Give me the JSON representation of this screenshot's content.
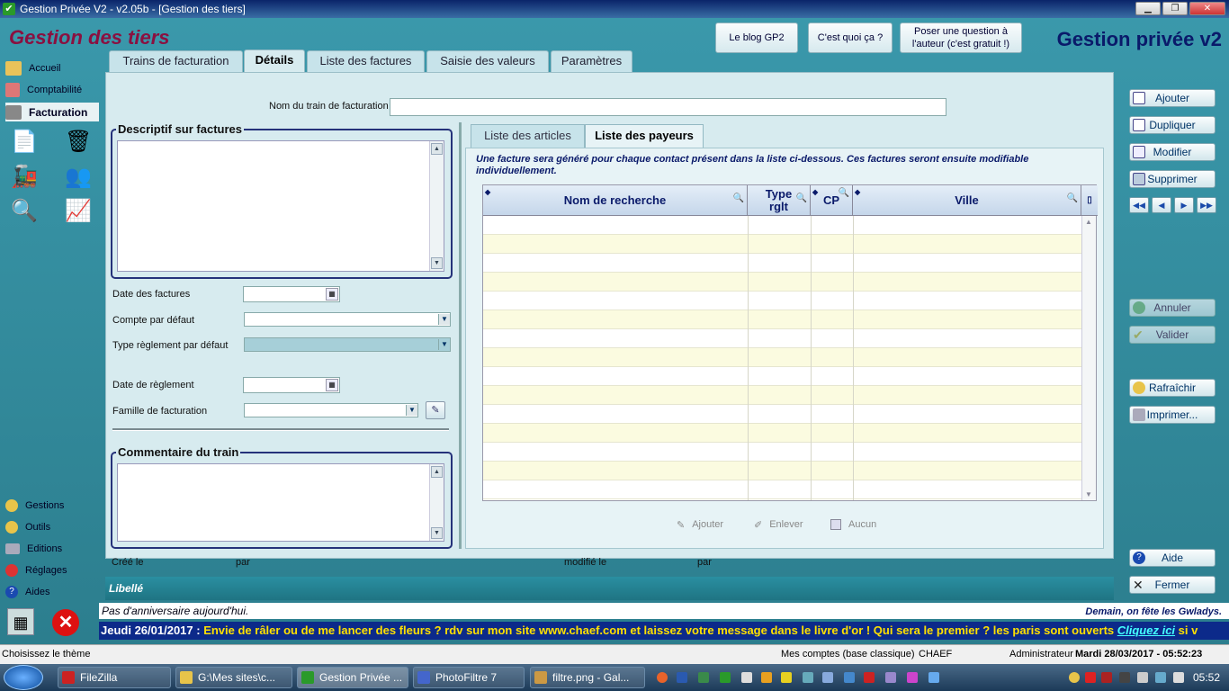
{
  "window": {
    "title": "Gestion Privée V2 - v2.05b - [Gestion des tiers]"
  },
  "header": {
    "page_title": "Gestion des tiers",
    "app_title": "Gestion privée v2",
    "buttons": {
      "blog": "Le blog GP2",
      "what": "C'est quoi ça ?",
      "question_l1": "Poser une question à",
      "question_l2": "l'auteur (c'est gratuit !)"
    }
  },
  "nav": {
    "top": [
      "Accueil",
      "Comptabilité",
      "Facturation"
    ],
    "bottom": [
      "Gestions",
      "Outils",
      "Editions",
      "Réglages",
      "Aides"
    ]
  },
  "tabs": [
    "Trains de facturation",
    "Détails",
    "Liste des factures",
    "Saisie des valeurs",
    "Paramètres"
  ],
  "form": {
    "train_name_label": "Nom du train de facturation",
    "train_name_value": "",
    "descriptif_title": "Descriptif sur factures",
    "date_factures_label": "Date des factures",
    "compte_label": "Compte par défaut",
    "type_reglement_label": "Type règlement par défaut",
    "date_reglement_label": "Date de règlement",
    "famille_label": "Famille de facturation",
    "commentaire_title": "Commentaire du train",
    "cree_label": "Créé le",
    "par_label": "par",
    "modifie_label": "modifié le",
    "par2_label": "par"
  },
  "subtabs": [
    "Liste des articles",
    "Liste des payeurs"
  ],
  "payeurs": {
    "info": "Une facture sera généré pour chaque contact présent dans la liste ci-dessous. Ces factures seront ensuite modifiable individuellement.",
    "columns": {
      "nom": "Nom de recherche",
      "type_l1": "Type",
      "type_l2": "rglt",
      "cp": "CP",
      "ville": "Ville"
    },
    "buttons": {
      "ajouter": "Ajouter",
      "enlever": "Enlever",
      "aucun": "Aucun"
    }
  },
  "actions": {
    "ajouter": "Ajouter",
    "dupliquer": "Dupliquer",
    "modifier": "Modifier",
    "supprimer": "Supprimer",
    "annuler": "Annuler",
    "valider": "Valider",
    "rafraichir": "Rafraîchir",
    "imprimer": "Imprimer...",
    "aide": "Aide",
    "fermer": "Fermer"
  },
  "footer": {
    "libelle": "Libellé",
    "birthday": "Pas d'anniversaire aujourd'hui.",
    "fete": "Demain, on fête les Gwladys.",
    "ticker_date": "Jeudi 26/01/2017 :",
    "ticker_text": " Envie de râler ou de me lancer des fleurs ? rdv sur mon site www.chaef.com et laissez votre message dans le livre d'or ! Qui sera le premier ? les paris sont ouverts ",
    "ticker_link": "Cliquez ici",
    "ticker_tail": " si v"
  },
  "statusbar": {
    "theme": "Choisissez le thème",
    "comptes": "Mes comptes (base classique)",
    "user": "CHAEF",
    "role": "Administrateur",
    "datetime": "Mardi 28/03/2017 - 05:52:23"
  },
  "taskbar": {
    "tasks": [
      "FileZilla",
      "G:\\Mes sites\\c...",
      "Gestion Privée ...",
      "PhotoFiltre 7",
      "filtre.png - Gal..."
    ],
    "clock": "05:52"
  },
  "colors": {
    "accent_title": "#8a1040",
    "app_title": "#0a1a6a",
    "ticker_bg": "#0c2a8a",
    "ticker_text": "#ffe000"
  }
}
